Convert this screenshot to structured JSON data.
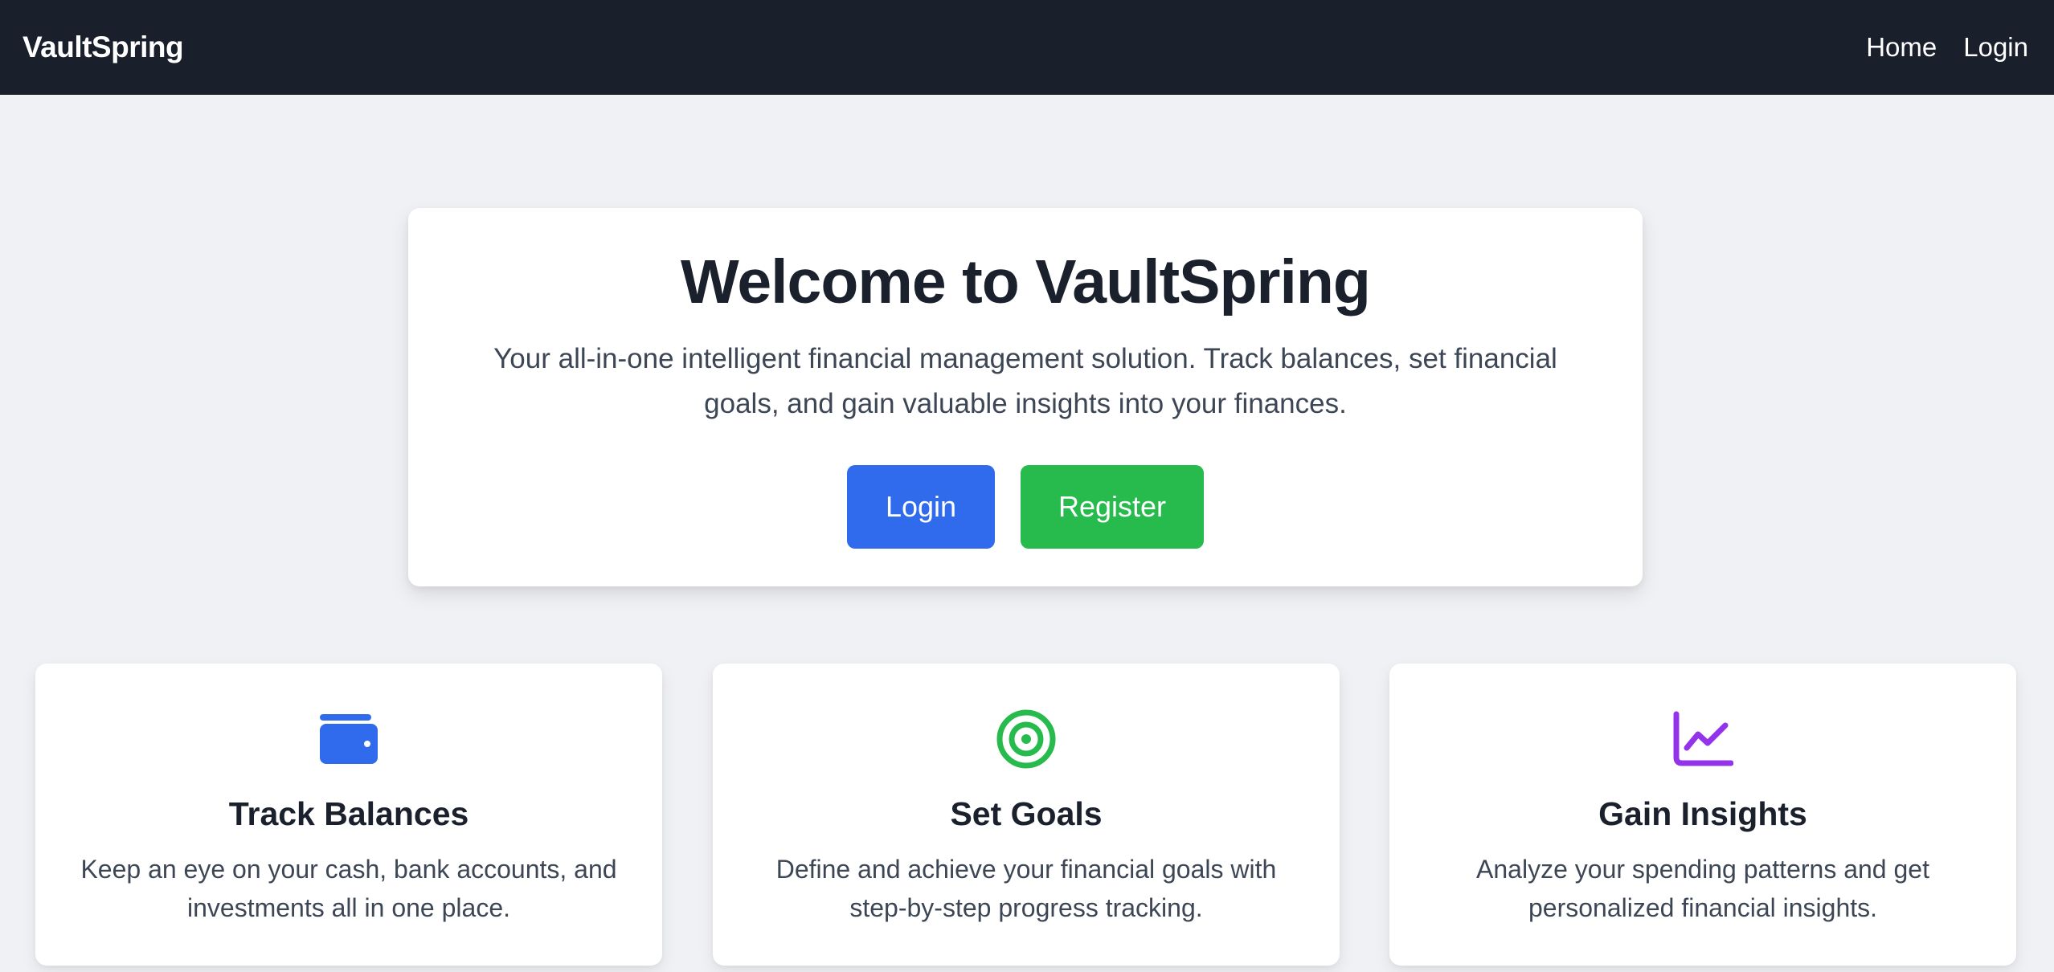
{
  "nav": {
    "brand": "VaultSpring",
    "links": [
      "Home",
      "Login"
    ]
  },
  "hero": {
    "title": "Welcome to VaultSpring",
    "subtitle": "Your all-in-one intelligent financial management solution. Track balances, set financial goals, and gain valuable insights into your finances.",
    "login_label": "Login",
    "register_label": "Register"
  },
  "features": [
    {
      "icon": "wallet-icon",
      "title": "Track Balances",
      "description": "Keep an eye on your cash, bank accounts, and investments all in one place."
    },
    {
      "icon": "target-icon",
      "title": "Set Goals",
      "description": "Define and achieve your financial goals with step-by-step progress tracking."
    },
    {
      "icon": "chart-line-icon",
      "title": "Gain Insights",
      "description": "Analyze your spending patterns and get personalized financial insights."
    }
  ],
  "colors": {
    "nav_bg": "#1a1f2c",
    "page_bg": "#f0f1f4",
    "login_button": "#2f6bec",
    "register_button": "#27bb4e",
    "wallet_icon": "#2f6bec",
    "target_icon": "#27bb4e",
    "chart_icon": "#9333ea"
  }
}
